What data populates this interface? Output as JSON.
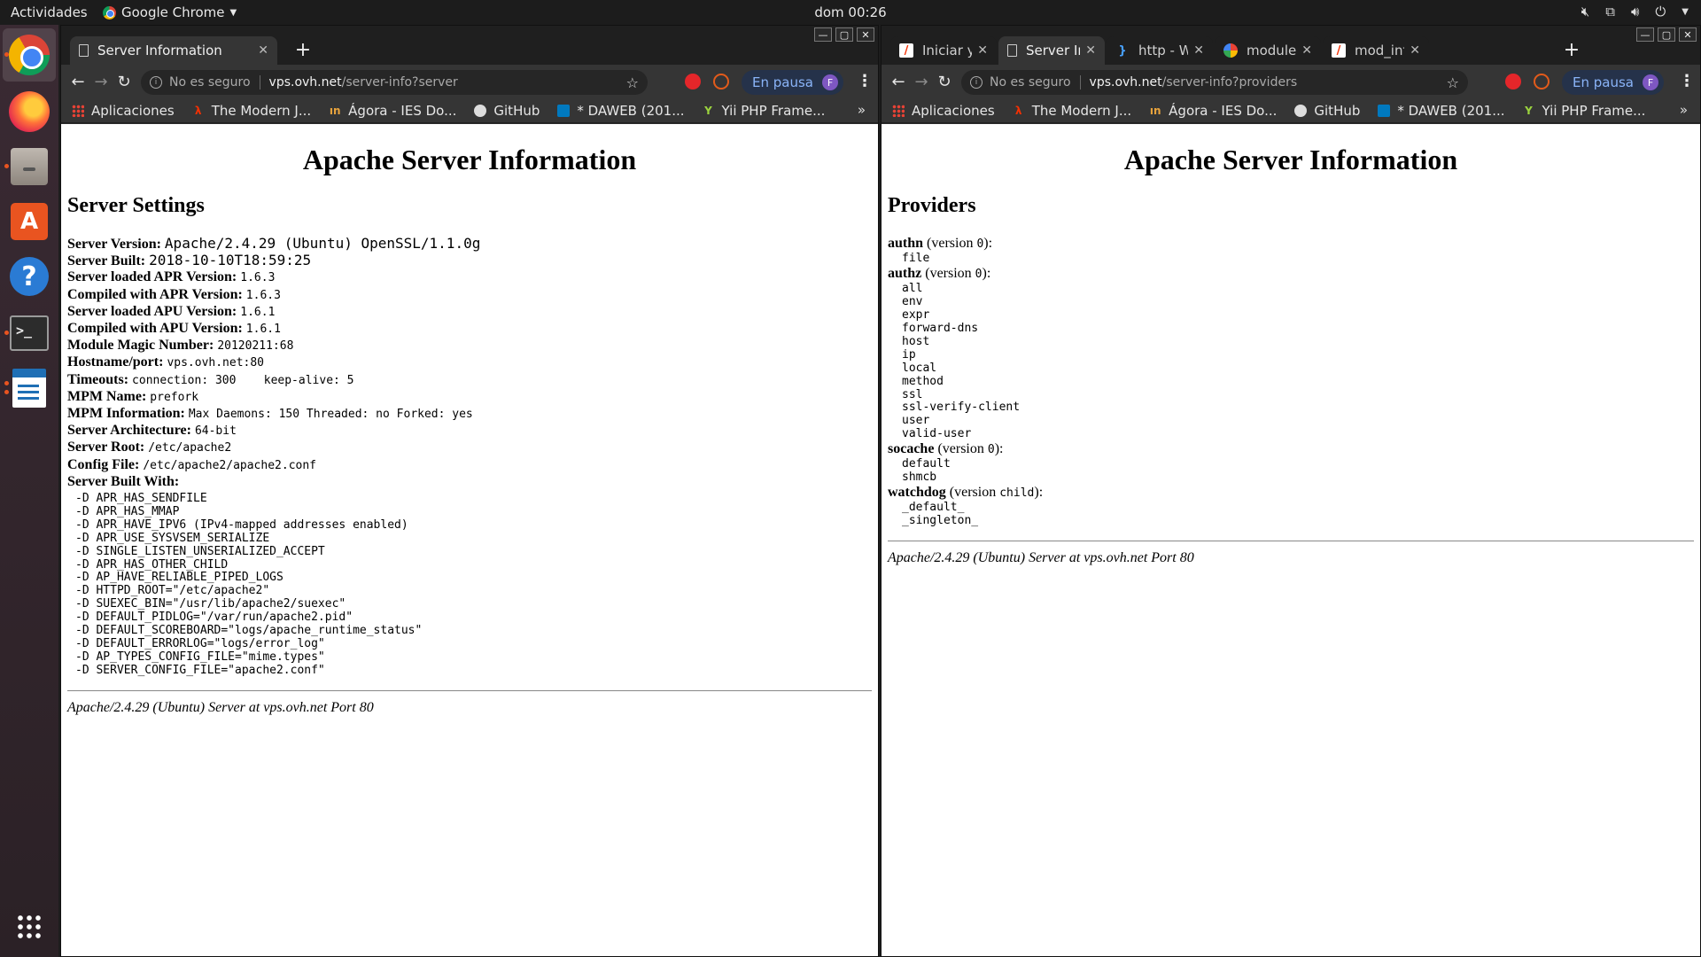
{
  "topbar": {
    "activities": "Actividades",
    "app_name": "Google Chrome",
    "clock": "dom 00:26"
  },
  "browser": {
    "insecure": "No es seguro",
    "paused": "En pausa",
    "profile_initial": "F",
    "bookmarks": [
      "Aplicaciones",
      "The Modern J...",
      "Ágora - IES Do...",
      "GitHub",
      "* DAWEB (201...",
      "Yii PHP Frame..."
    ],
    "bookmarks_more": "»"
  },
  "left": {
    "tab_title": "Server Information",
    "url_host": "vps.ovh.net",
    "url_path": "/server-info?server",
    "page_title": "Apache Server Information",
    "section": "Server Settings",
    "settings": [
      {
        "label": "Server Version:",
        "value": "Apache/2.4.29 (Ubuntu) OpenSSL/1.1.0g"
      },
      {
        "label": "Server Built:",
        "value": "2018-10-10T18:59:25"
      },
      {
        "label": "Server loaded APR Version:",
        "value": "1.6.3"
      },
      {
        "label": "Compiled with APR Version:",
        "value": "1.6.3"
      },
      {
        "label": "Server loaded APU Version:",
        "value": "1.6.1"
      },
      {
        "label": "Compiled with APU Version:",
        "value": "1.6.1"
      },
      {
        "label": "Module Magic Number:",
        "value": "20120211:68"
      },
      {
        "label": "Hostname/port:",
        "value": "vps.ovh.net:80"
      },
      {
        "label": "Timeouts:",
        "value": "connection: 300    keep-alive: 5"
      },
      {
        "label": "MPM Name:",
        "value": "prefork"
      },
      {
        "label": "MPM Information:",
        "value": "Max Daemons: 150 Threaded: no Forked: yes"
      },
      {
        "label": "Server Architecture:",
        "value": "64-bit"
      },
      {
        "label": "Server Root:",
        "value": "/etc/apache2"
      },
      {
        "label": "Config File:",
        "value": "/etc/apache2/apache2.conf"
      },
      {
        "label": "Server Built With:",
        "value": ""
      }
    ],
    "built_with": [
      "-D APR_HAS_SENDFILE",
      "-D APR_HAS_MMAP",
      "-D APR_HAVE_IPV6 (IPv4-mapped addresses enabled)",
      "-D APR_USE_SYSVSEM_SERIALIZE",
      "-D SINGLE_LISTEN_UNSERIALIZED_ACCEPT",
      "-D APR_HAS_OTHER_CHILD",
      "-D AP_HAVE_RELIABLE_PIPED_LOGS",
      "-D HTTPD_ROOT=\"/etc/apache2\"",
      "-D SUEXEC_BIN=\"/usr/lib/apache2/suexec\"",
      "-D DEFAULT_PIDLOG=\"/var/run/apache2.pid\"",
      "-D DEFAULT_SCOREBOARD=\"logs/apache_runtime_status\"",
      "-D DEFAULT_ERRORLOG=\"logs/error_log\"",
      "-D AP_TYPES_CONFIG_FILE=\"mime.types\"",
      "-D SERVER_CONFIG_FILE=\"apache2.conf\""
    ],
    "footer": "Apache/2.4.29 (Ubuntu) Server at vps.ovh.net Port 80"
  },
  "right": {
    "tabs": [
      {
        "title": "Iniciar y Para",
        "icon": "laravel-icon"
      },
      {
        "title": "Server Inform",
        "icon": "page-icon"
      },
      {
        "title": "http - Wget I",
        "icon": "brace-icon"
      },
      {
        "title": "module nam",
        "icon": "google-icon"
      },
      {
        "title": "mod_info - A",
        "icon": "laravel-icon"
      }
    ],
    "url_host": "vps.ovh.net",
    "url_path": "/server-info?providers",
    "page_title": "Apache Server Information",
    "section": "Providers",
    "providers": [
      {
        "name": "authn",
        "version_pre": " (version ",
        "version": "0",
        "version_post": "):",
        "items": [
          "file"
        ]
      },
      {
        "name": "authz",
        "version_pre": " (version ",
        "version": "0",
        "version_post": "):",
        "items": [
          "all",
          "env",
          "expr",
          "forward-dns",
          "host",
          "ip",
          "local",
          "method",
          "ssl",
          "ssl-verify-client",
          "user",
          "valid-user"
        ]
      },
      {
        "name": "socache",
        "version_pre": " (version ",
        "version": "0",
        "version_post": "):",
        "items": [
          "default",
          "shmcb"
        ]
      },
      {
        "name": "watchdog",
        "version_pre": " (version ",
        "version": "child",
        "version_post": "):",
        "items": [
          "_default_",
          "_singleton_"
        ]
      }
    ],
    "footer": "Apache/2.4.29 (Ubuntu) Server at vps.ovh.net Port 80"
  }
}
